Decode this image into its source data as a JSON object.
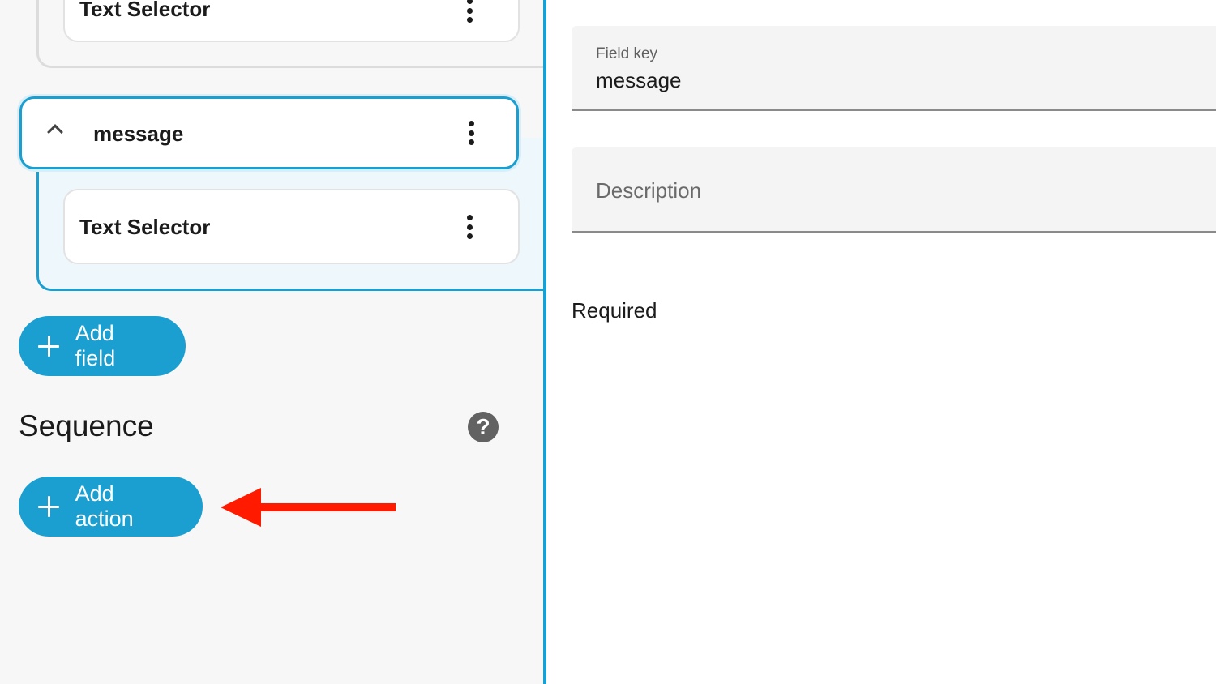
{
  "fields": {
    "previous_selector_label": "Text Selector",
    "current_field": {
      "name": "message",
      "selector_label": "Text Selector"
    }
  },
  "buttons": {
    "add_field": "Add field",
    "add_action": "Add action"
  },
  "sequence": {
    "title": "Sequence",
    "help_icon_glyph": "?"
  },
  "editor": {
    "field_key_label": "Field key",
    "field_key_value": "message",
    "description_placeholder": "Description",
    "required_label": "Required"
  },
  "colors": {
    "accent": "#1a9fd0",
    "annotation": "#ff1a00"
  },
  "icons": [
    "chevron-up-icon",
    "kebab-menu-icon",
    "plus-icon",
    "help-icon",
    "arrow-left-icon"
  ]
}
